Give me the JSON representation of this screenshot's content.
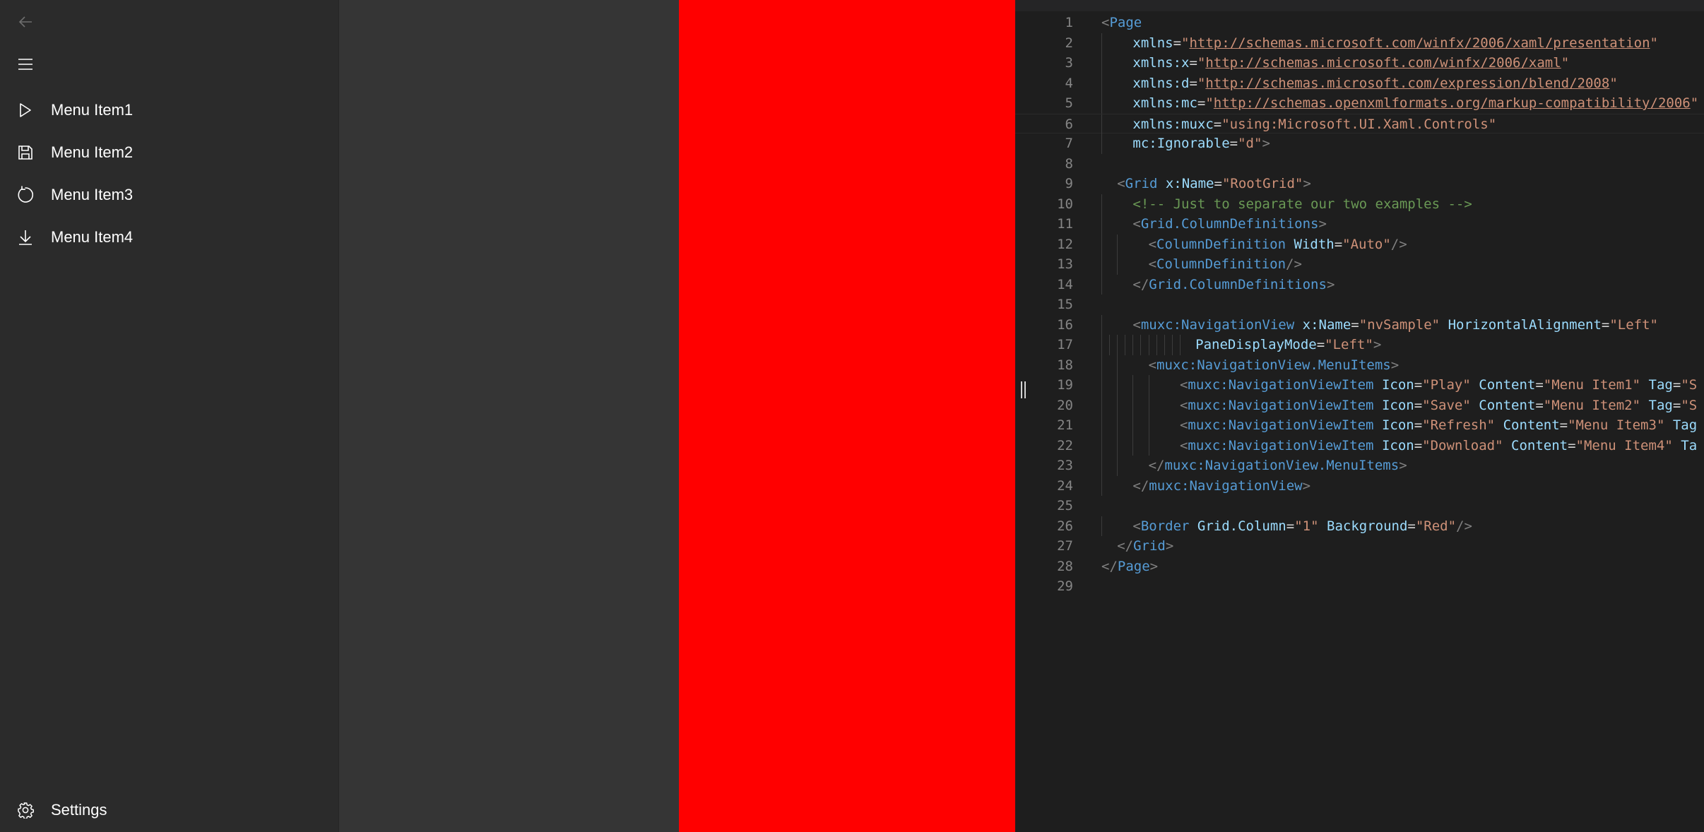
{
  "nav": {
    "menu_items": [
      {
        "label": "Menu Item1",
        "icon": "play-icon"
      },
      {
        "label": "Menu Item2",
        "icon": "save-icon"
      },
      {
        "label": "Menu Item3",
        "icon": "refresh-icon"
      },
      {
        "label": "Menu Item4",
        "icon": "download-icon"
      }
    ],
    "settings_label": "Settings"
  },
  "content": {
    "border_background": "#ff0000"
  },
  "code_lines": [
    [
      [
        "tb",
        "<"
      ],
      [
        "tg",
        "Page"
      ]
    ],
    [
      [
        "at",
        "xmlns"
      ],
      [
        "pl",
        "="
      ],
      [
        "vl",
        "\""
      ],
      [
        "ul",
        "http://schemas.microsoft.com/winfx/2006/xaml/presentation"
      ],
      [
        "vl",
        "\""
      ]
    ],
    [
      [
        "at",
        "xmlns:x"
      ],
      [
        "pl",
        "="
      ],
      [
        "vl",
        "\""
      ],
      [
        "ul",
        "http://schemas.microsoft.com/winfx/2006/xaml"
      ],
      [
        "vl",
        "\""
      ]
    ],
    [
      [
        "at",
        "xmlns:d"
      ],
      [
        "pl",
        "="
      ],
      [
        "vl",
        "\""
      ],
      [
        "ul",
        "http://schemas.microsoft.com/expression/blend/2008"
      ],
      [
        "vl",
        "\""
      ]
    ],
    [
      [
        "at",
        "xmlns:mc"
      ],
      [
        "pl",
        "="
      ],
      [
        "vl",
        "\""
      ],
      [
        "ul",
        "http://schemas.openxmlformats.org/markup-compatibility/2006"
      ],
      [
        "vl",
        "\""
      ]
    ],
    [
      [
        "at",
        "xmlns:muxc"
      ],
      [
        "pl",
        "="
      ],
      [
        "vl",
        "\"using:Microsoft.UI.Xaml.Controls\""
      ]
    ],
    [
      [
        "at",
        "mc:Ignorable"
      ],
      [
        "pl",
        "="
      ],
      [
        "vl",
        "\"d\""
      ],
      [
        "tb",
        ">"
      ]
    ],
    [],
    [
      [
        "tb",
        "<"
      ],
      [
        "tg",
        "Grid"
      ],
      [
        "pl",
        " "
      ],
      [
        "at",
        "x:Name"
      ],
      [
        "pl",
        "="
      ],
      [
        "vl",
        "\"RootGrid\""
      ],
      [
        "tb",
        ">"
      ]
    ],
    [
      [
        "cm",
        "<!-- Just to separate our two examples -->"
      ]
    ],
    [
      [
        "tb",
        "<"
      ],
      [
        "tg",
        "Grid.ColumnDefinitions"
      ],
      [
        "tb",
        ">"
      ]
    ],
    [
      [
        "tb",
        "<"
      ],
      [
        "tg",
        "ColumnDefinition"
      ],
      [
        "pl",
        " "
      ],
      [
        "at",
        "Width"
      ],
      [
        "pl",
        "="
      ],
      [
        "vl",
        "\"Auto\""
      ],
      [
        "tb",
        "/>"
      ]
    ],
    [
      [
        "tb",
        "<"
      ],
      [
        "tg",
        "ColumnDefinition"
      ],
      [
        "tb",
        "/>"
      ]
    ],
    [
      [
        "tb",
        "</"
      ],
      [
        "tg",
        "Grid.ColumnDefinitions"
      ],
      [
        "tb",
        ">"
      ]
    ],
    [],
    [
      [
        "tb",
        "<"
      ],
      [
        "tg",
        "muxc:NavigationView"
      ],
      [
        "pl",
        " "
      ],
      [
        "at",
        "x:Name"
      ],
      [
        "pl",
        "="
      ],
      [
        "vl",
        "\"nvSample\""
      ],
      [
        "pl",
        " "
      ],
      [
        "at",
        "HorizontalAlignment"
      ],
      [
        "pl",
        "="
      ],
      [
        "vl",
        "\"Left\""
      ]
    ],
    [
      [
        "at",
        "PaneDisplayMode"
      ],
      [
        "pl",
        "="
      ],
      [
        "vl",
        "\"Left\""
      ],
      [
        "tb",
        ">"
      ]
    ],
    [
      [
        "tb",
        "<"
      ],
      [
        "tg",
        "muxc:NavigationView.MenuItems"
      ],
      [
        "tb",
        ">"
      ]
    ],
    [
      [
        "tb",
        "<"
      ],
      [
        "tg",
        "muxc:NavigationViewItem"
      ],
      [
        "pl",
        " "
      ],
      [
        "at",
        "Icon"
      ],
      [
        "pl",
        "="
      ],
      [
        "vl",
        "\"Play\""
      ],
      [
        "pl",
        " "
      ],
      [
        "at",
        "Content"
      ],
      [
        "pl",
        "="
      ],
      [
        "vl",
        "\"Menu Item1\""
      ],
      [
        "pl",
        " "
      ],
      [
        "at",
        "Tag"
      ],
      [
        "pl",
        "="
      ],
      [
        "vl",
        "\"S"
      ]
    ],
    [
      [
        "tb",
        "<"
      ],
      [
        "tg",
        "muxc:NavigationViewItem"
      ],
      [
        "pl",
        " "
      ],
      [
        "at",
        "Icon"
      ],
      [
        "pl",
        "="
      ],
      [
        "vl",
        "\"Save\""
      ],
      [
        "pl",
        " "
      ],
      [
        "at",
        "Content"
      ],
      [
        "pl",
        "="
      ],
      [
        "vl",
        "\"Menu Item2\""
      ],
      [
        "pl",
        " "
      ],
      [
        "at",
        "Tag"
      ],
      [
        "pl",
        "="
      ],
      [
        "vl",
        "\"S"
      ]
    ],
    [
      [
        "tb",
        "<"
      ],
      [
        "tg",
        "muxc:NavigationViewItem"
      ],
      [
        "pl",
        " "
      ],
      [
        "at",
        "Icon"
      ],
      [
        "pl",
        "="
      ],
      [
        "vl",
        "\"Refresh\""
      ],
      [
        "pl",
        " "
      ],
      [
        "at",
        "Content"
      ],
      [
        "pl",
        "="
      ],
      [
        "vl",
        "\"Menu Item3\""
      ],
      [
        "pl",
        " "
      ],
      [
        "at",
        "Tag"
      ]
    ],
    [
      [
        "tb",
        "<"
      ],
      [
        "tg",
        "muxc:NavigationViewItem"
      ],
      [
        "pl",
        " "
      ],
      [
        "at",
        "Icon"
      ],
      [
        "pl",
        "="
      ],
      [
        "vl",
        "\"Download\""
      ],
      [
        "pl",
        " "
      ],
      [
        "at",
        "Content"
      ],
      [
        "pl",
        "="
      ],
      [
        "vl",
        "\"Menu Item4\""
      ],
      [
        "pl",
        " "
      ],
      [
        "at",
        "Ta"
      ]
    ],
    [
      [
        "tb",
        "</"
      ],
      [
        "tg",
        "muxc:NavigationView.MenuItems"
      ],
      [
        "tb",
        ">"
      ]
    ],
    [
      [
        "tb",
        "</"
      ],
      [
        "tg",
        "muxc:NavigationView"
      ],
      [
        "tb",
        ">"
      ]
    ],
    [],
    [
      [
        "tb",
        "<"
      ],
      [
        "tg",
        "Border"
      ],
      [
        "pl",
        " "
      ],
      [
        "at",
        "Grid.Column"
      ],
      [
        "pl",
        "="
      ],
      [
        "vl",
        "\"1\""
      ],
      [
        "pl",
        " "
      ],
      [
        "at",
        "Background"
      ],
      [
        "pl",
        "="
      ],
      [
        "vl",
        "\"Red\""
      ],
      [
        "tb",
        "/>"
      ]
    ],
    [
      [
        "tb",
        "</"
      ],
      [
        "tg",
        "Grid"
      ],
      [
        "tb",
        ">"
      ]
    ],
    [
      [
        "tb",
        "</"
      ],
      [
        "tg",
        "Page"
      ],
      [
        "tb",
        ">"
      ]
    ],
    []
  ]
}
